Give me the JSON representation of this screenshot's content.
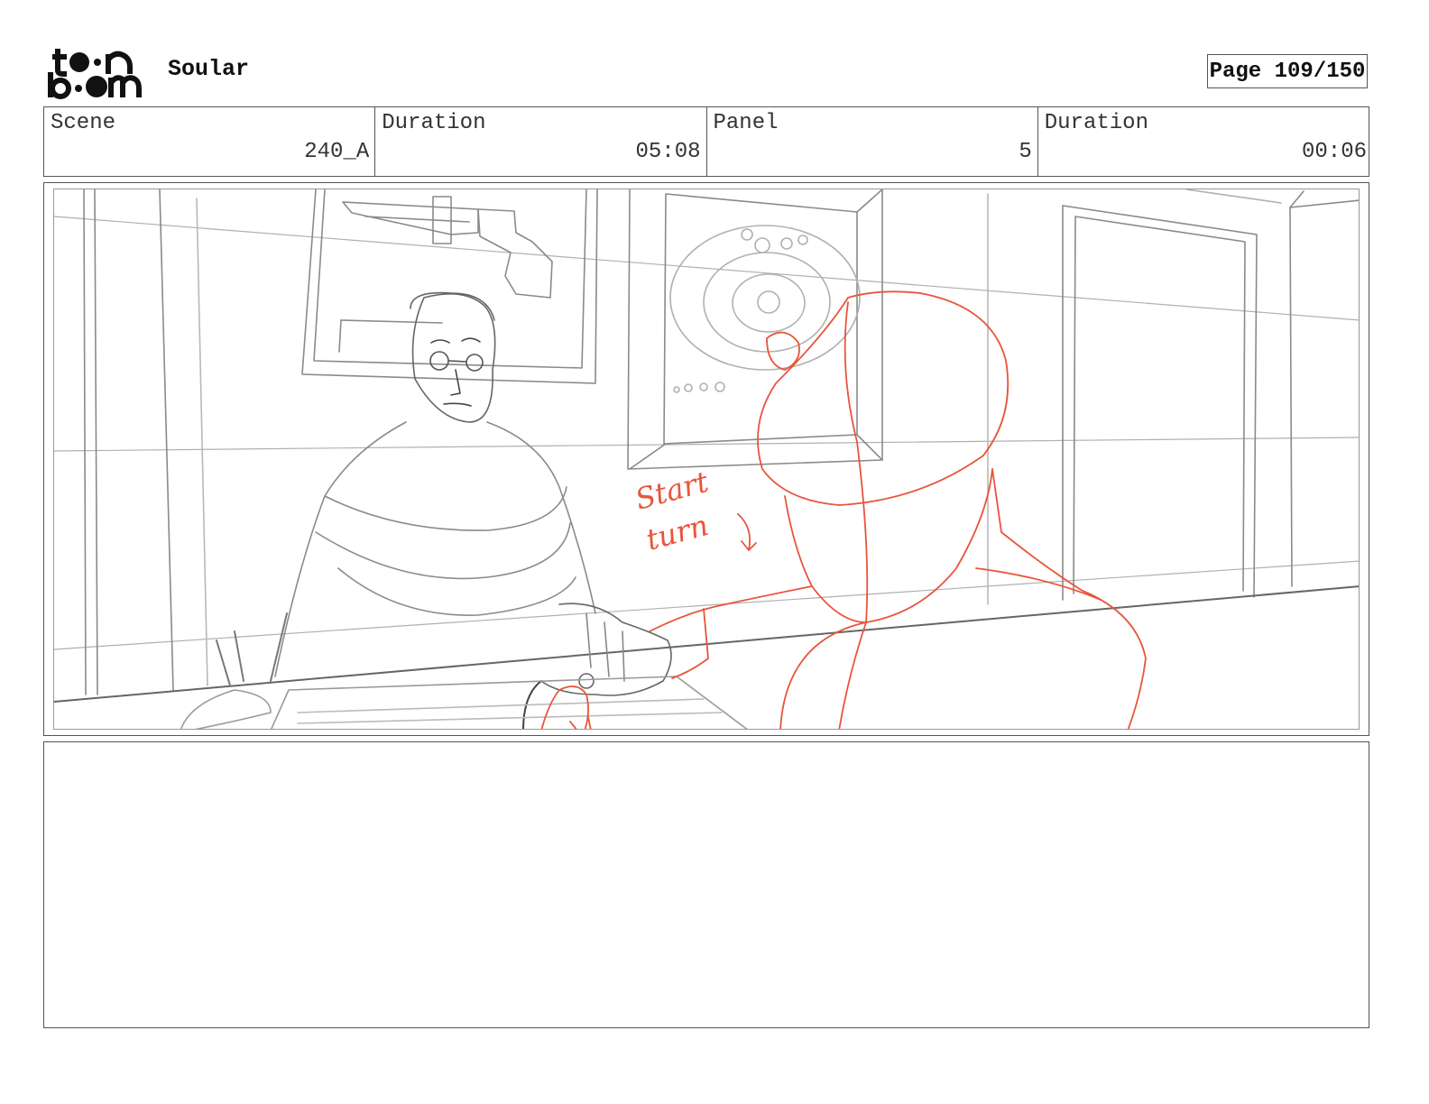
{
  "header": {
    "logo_text": "toon boom",
    "project_title": "Soular",
    "page_label": "Page 109/150"
  },
  "info": {
    "scene_label": "Scene",
    "scene_value": "240_A",
    "scene_duration_label": "Duration",
    "scene_duration_value": "05:08",
    "panel_label": "Panel",
    "panel_value": "5",
    "panel_duration_label": "Duration",
    "panel_duration_value": "00:06"
  },
  "panel": {
    "annotation_line1": "Start",
    "annotation_line2": "turn",
    "colors": {
      "sketch": "#8a8a8a",
      "annotation": "#e8553a"
    }
  },
  "notes": {
    "text": ""
  }
}
